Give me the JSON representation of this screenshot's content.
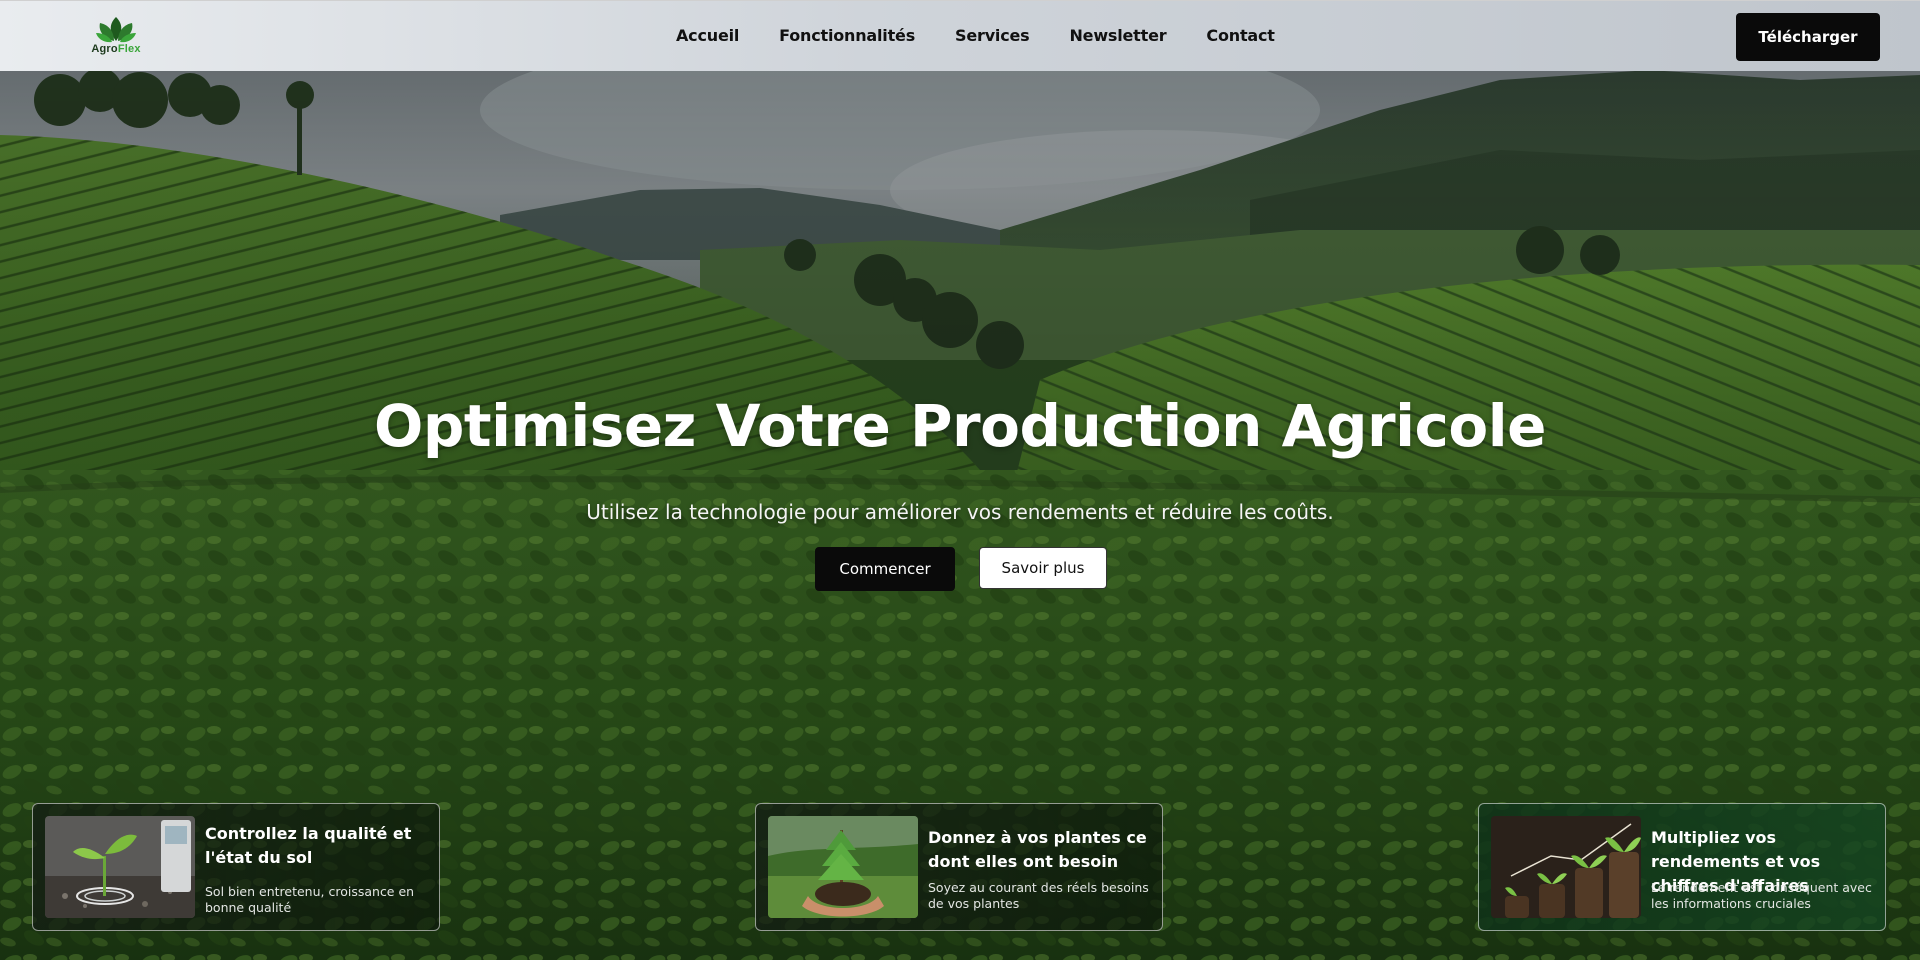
{
  "brand": {
    "name_part1": "Agro",
    "name_part2": "Flex"
  },
  "nav": {
    "items": [
      {
        "label": "Accueil"
      },
      {
        "label": "Fonctionnalités"
      },
      {
        "label": "Services"
      },
      {
        "label": "Newsletter"
      },
      {
        "label": "Contact"
      }
    ],
    "download_label": "Télécharger"
  },
  "hero": {
    "title": "Optimisez Votre Production Agricole",
    "subtitle": "Utilisez la technologie pour améliorer vos rendements et réduire les coûts.",
    "primary_label": "Commencer",
    "secondary_label": "Savoir plus"
  },
  "cards": [
    {
      "title": "Controllez la qualité et l'état du sol",
      "text": "Sol bien entretenu, croissance en bonne qualité",
      "icon": "sprout-soil-sensor-image"
    },
    {
      "title": "Donnez à vos plantes ce dont elles ont besoin",
      "text": "Soyez au courant des réels besoins de vos plantes",
      "icon": "hands-holding-plant-image"
    },
    {
      "title": "Multipliez vos rendements et vos chiffres d'affaires",
      "text": "Le rendement est conséquent avec les informations cruciales",
      "icon": "growing-plants-coins-image"
    }
  ],
  "colors": {
    "header_bg": "#cfd4da",
    "button_dark": "#0a0a0a",
    "brand_green": "#3aa53a"
  }
}
